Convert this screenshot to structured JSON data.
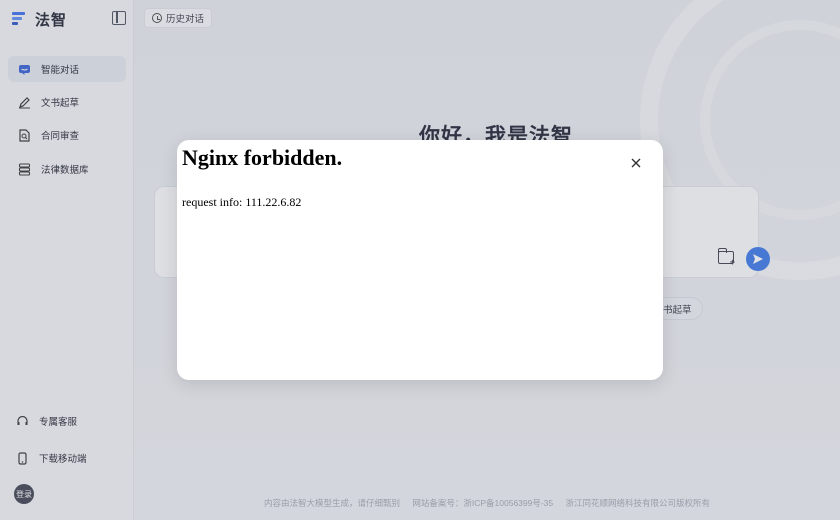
{
  "brand": {
    "name": "法智"
  },
  "sidebar": {
    "items": [
      {
        "label": "智能对话",
        "icon": "chat-icon"
      },
      {
        "label": "文书起草",
        "icon": "pen-icon"
      },
      {
        "label": "合同审查",
        "icon": "document-search-icon"
      },
      {
        "label": "法律数据库",
        "icon": "database-icon"
      }
    ],
    "bottom": [
      {
        "label": "专属客服",
        "icon": "headset-icon"
      },
      {
        "label": "下载移动端",
        "icon": "mobile-icon"
      }
    ],
    "login_label": "登录"
  },
  "main": {
    "history_label": "历史对话",
    "greeting": "你好，我是法智",
    "chip_label": "书起草",
    "footer": [
      "内容由法智大模型生成，请仔细甄别",
      "网站备案号：浙ICP备10056399号-35",
      "浙江同花顺网络科技有限公司版权所有"
    ]
  },
  "modal": {
    "title": "Nginx forbidden.",
    "body": "request info: 111.22.6.82",
    "close_icon": "close-icon"
  },
  "colors": {
    "accent": "#3a78e8",
    "brand": "#3a6df0"
  }
}
